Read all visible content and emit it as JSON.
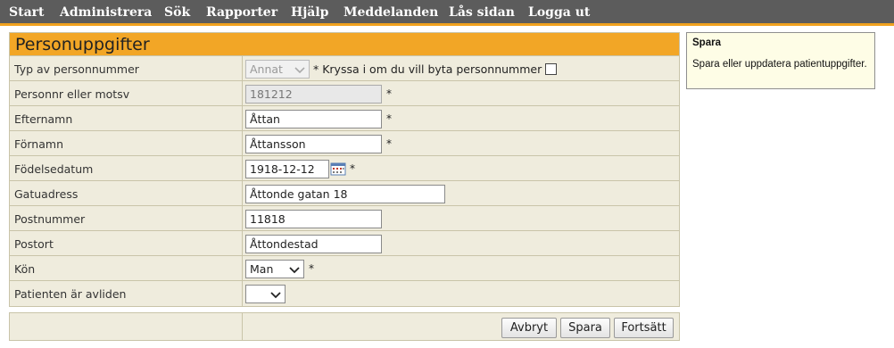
{
  "nav": {
    "items": [
      "Start",
      "Administrera",
      "Sök",
      "Rapporter",
      "Hjälp",
      "Meddelanden",
      "Lås sidan",
      "Logga ut"
    ]
  },
  "form": {
    "title": "Personuppgifter",
    "fields": {
      "typ": {
        "label": "Typ av personnummer",
        "value": "Annat",
        "note": "* Kryssa i om du vill byta personnummer"
      },
      "personnr": {
        "label": "Personnr eller motsv",
        "value": "181212"
      },
      "efternamn": {
        "label": "Efternamn",
        "value": "Åttan"
      },
      "fornamn": {
        "label": "Förnamn",
        "value": "Åttansson"
      },
      "fodelsedatum": {
        "label": "Födelsedatum",
        "value": "1918-12-12"
      },
      "gatuadress": {
        "label": "Gatuadress",
        "value": "Åttonde gatan 18"
      },
      "postnummer": {
        "label": "Postnummer",
        "value": "11818"
      },
      "postort": {
        "label": "Postort",
        "value": "Åttondestad"
      },
      "kon": {
        "label": "Kön",
        "value": "Man"
      },
      "avliden": {
        "label": "Patienten är avliden",
        "value": ""
      }
    },
    "required_mark": "*"
  },
  "buttons": {
    "cancel": "Avbryt",
    "save": "Spara",
    "continue": "Fortsätt"
  },
  "help": {
    "title": "Spara",
    "text": "Spara eller uppdatera patientuppgifter."
  },
  "colors": {
    "nav_bg": "#5c5c5c",
    "accent": "#f2a626",
    "form_bg": "#efecdd",
    "help_bg": "#fefde6"
  }
}
